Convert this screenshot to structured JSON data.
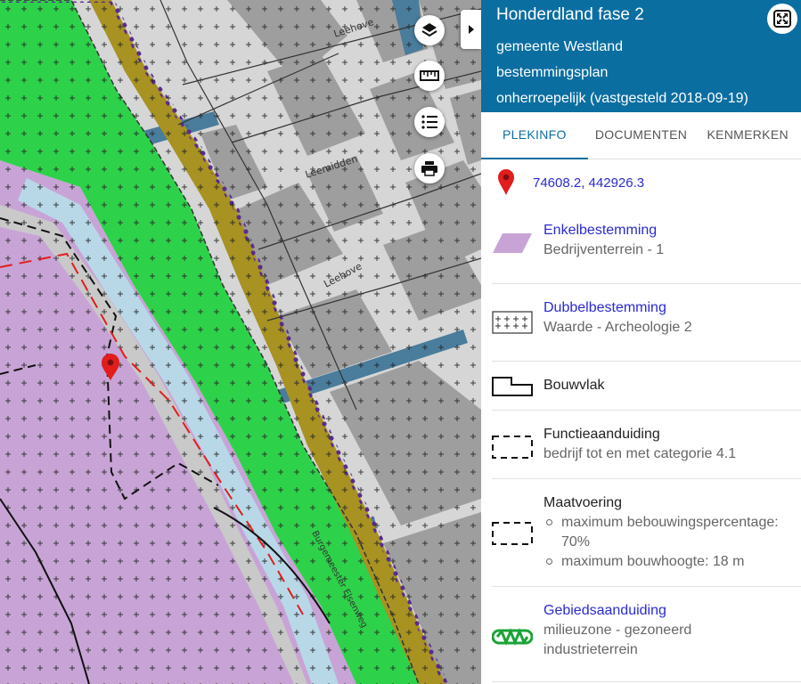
{
  "header": {
    "title": "Honderdland fase 2",
    "lines": [
      "gemeente Westland",
      "bestemmingsplan",
      "onherroepelijk (vastgesteld 2018-09-19)"
    ]
  },
  "tabs": [
    "PLEKINFO",
    "DOCUMENTEN",
    "KENMERKEN"
  ],
  "active_tab": "PLEKINFO",
  "location": {
    "coordinates": "74608.2, 442926.3",
    "icon": "map-marker-icon"
  },
  "items": [
    {
      "title": "Enkelbestemming",
      "subtitle": "Bedrijventerrein - 1",
      "symbol": "purple-parallelogram"
    },
    {
      "title": "Dubbelbestemming",
      "subtitle": "Waarde - Archeologie 2",
      "symbol": "cross-hatch-box"
    },
    {
      "title": "Bouwvlak",
      "symbol": "building-outline"
    },
    {
      "title": "Functieaanduiding",
      "subtitle": "bedrijf tot en met categorie 4.1",
      "symbol": "dashed-box"
    },
    {
      "title": "Maatvoering",
      "bullets": [
        "maximum bebouwingspercentage: 70%",
        "maximum bouwhoogte: 18 m"
      ],
      "symbol": "dashed-box"
    },
    {
      "title": "Gebiedsaanduiding",
      "subtitle": "milieuzone - gezoneerd industrieterrein",
      "symbol": "green-zigzag"
    }
  ],
  "map": {
    "street_labels": [
      "Leehove",
      "Leemidden",
      "Leehove",
      "Burgemeester Elsenweg"
    ],
    "buttons": [
      "layers-icon",
      "measure-ruler-icon",
      "legend-list-icon",
      "print-icon"
    ],
    "colors": {
      "industrial": "#c8a4d6",
      "green": "#2ed24a",
      "road": "#a79222",
      "water": "#4a7c9c",
      "buildings": "#9a9a9a",
      "background": "#d6d6d6",
      "marker": "#e11d1d"
    }
  }
}
